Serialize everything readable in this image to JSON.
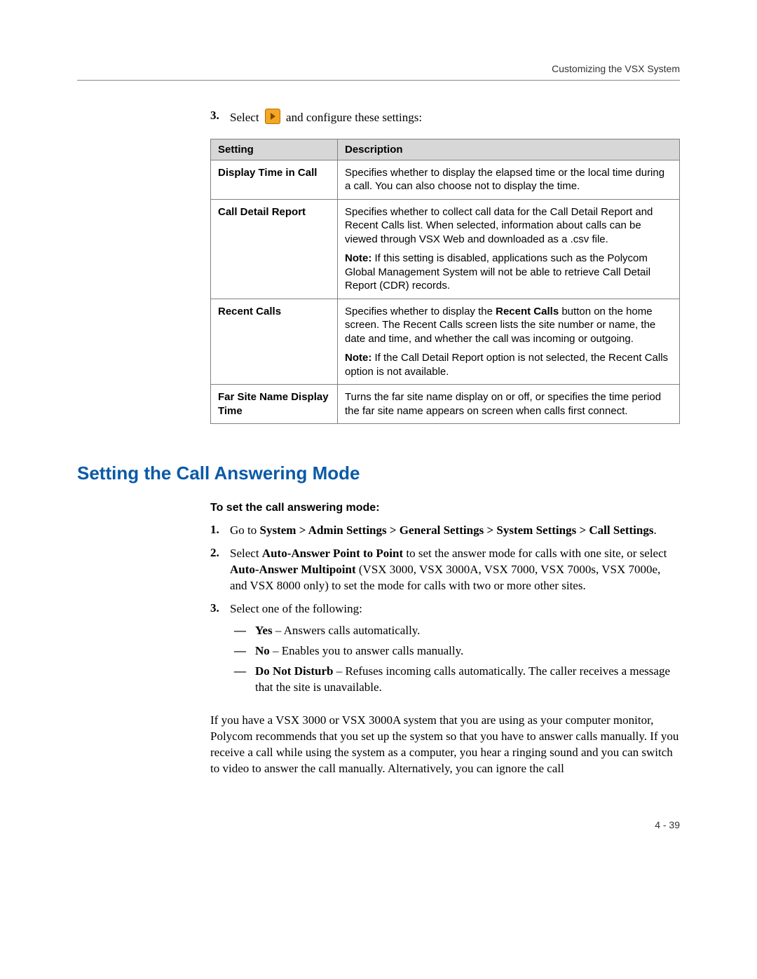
{
  "header": {
    "running_title": "Customizing the VSX System"
  },
  "step3": {
    "number": "3.",
    "pre_icon": "Select ",
    "post_icon": " and configure these settings:"
  },
  "table": {
    "col_setting": "Setting",
    "col_description": "Description",
    "rows": [
      {
        "setting": "Display Time in Call",
        "desc": [
          {
            "plain": "Specifies whether to display the elapsed time or the local time during a call. You can also choose not to display the time."
          }
        ]
      },
      {
        "setting": "Call Detail Report",
        "desc": [
          {
            "plain": "Specifies whether to collect call data for the Call Detail Report and Recent Calls list. When selected, information about calls can be viewed through VSX Web and downloaded as a .csv file."
          },
          {
            "lead_bold": "Note:",
            "rest": " If this setting is disabled, applications such as the Polycom Global Management System will not be able to retrieve Call Detail Report (CDR) records."
          }
        ]
      },
      {
        "setting": "Recent Calls",
        "desc": [
          {
            "pre": "Specifies whether to display the ",
            "mid_bold": "Recent Calls",
            "post": " button on the home screen. The Recent Calls screen lists the site number or name, the date and time, and whether the call was incoming or outgoing."
          },
          {
            "lead_bold": "Note:",
            "rest": " If the Call Detail Report option is not selected, the Recent Calls option is not available."
          }
        ]
      },
      {
        "setting": "Far Site Name Display Time",
        "desc": [
          {
            "plain": "Turns the far site name display on or off, or specifies the time period the far site name appears on screen when calls first connect."
          }
        ]
      }
    ]
  },
  "section": {
    "title": "Setting the Call Answering Mode",
    "subhead": "To set the call answering mode:",
    "steps": [
      {
        "number": "1.",
        "runs": [
          {
            "t": "Go to "
          },
          {
            "t": "System > Admin Settings > General Settings > System Settings > Call Settings",
            "b": true
          },
          {
            "t": "."
          }
        ]
      },
      {
        "number": "2.",
        "runs": [
          {
            "t": "Select "
          },
          {
            "t": "Auto-Answer Point to Point",
            "b": true
          },
          {
            "t": " to set the answer mode for calls with one site, or select "
          },
          {
            "t": "Auto-Answer Multipoint",
            "b": true
          },
          {
            "t": " (VSX 3000, VSX 3000A, VSX 7000, VSX 7000s, VSX 7000e, and VSX 8000 only) to set the mode for calls with two or more other sites."
          }
        ]
      },
      {
        "number": "3.",
        "runs": [
          {
            "t": "Select one of the following:"
          }
        ],
        "sublist": [
          {
            "lead": "Yes",
            "rest": " – Answers calls automatically."
          },
          {
            "lead": "No",
            "rest": " – Enables you to answer calls manually."
          },
          {
            "lead": "Do Not Disturb",
            "rest": " – Refuses incoming calls automatically. The caller receives a message that the site is unavailable."
          }
        ]
      }
    ],
    "trailing": "If you have a VSX 3000 or VSX 3000A system that you are using as your computer monitor, Polycom recommends that you set up the system so that you have to answer calls manually. If you receive a call while using the system as a computer, you hear a ringing sound and you can switch to video to answer the call manually. Alternatively, you can ignore the call"
  },
  "footer": {
    "page_number": "4 - 39"
  }
}
